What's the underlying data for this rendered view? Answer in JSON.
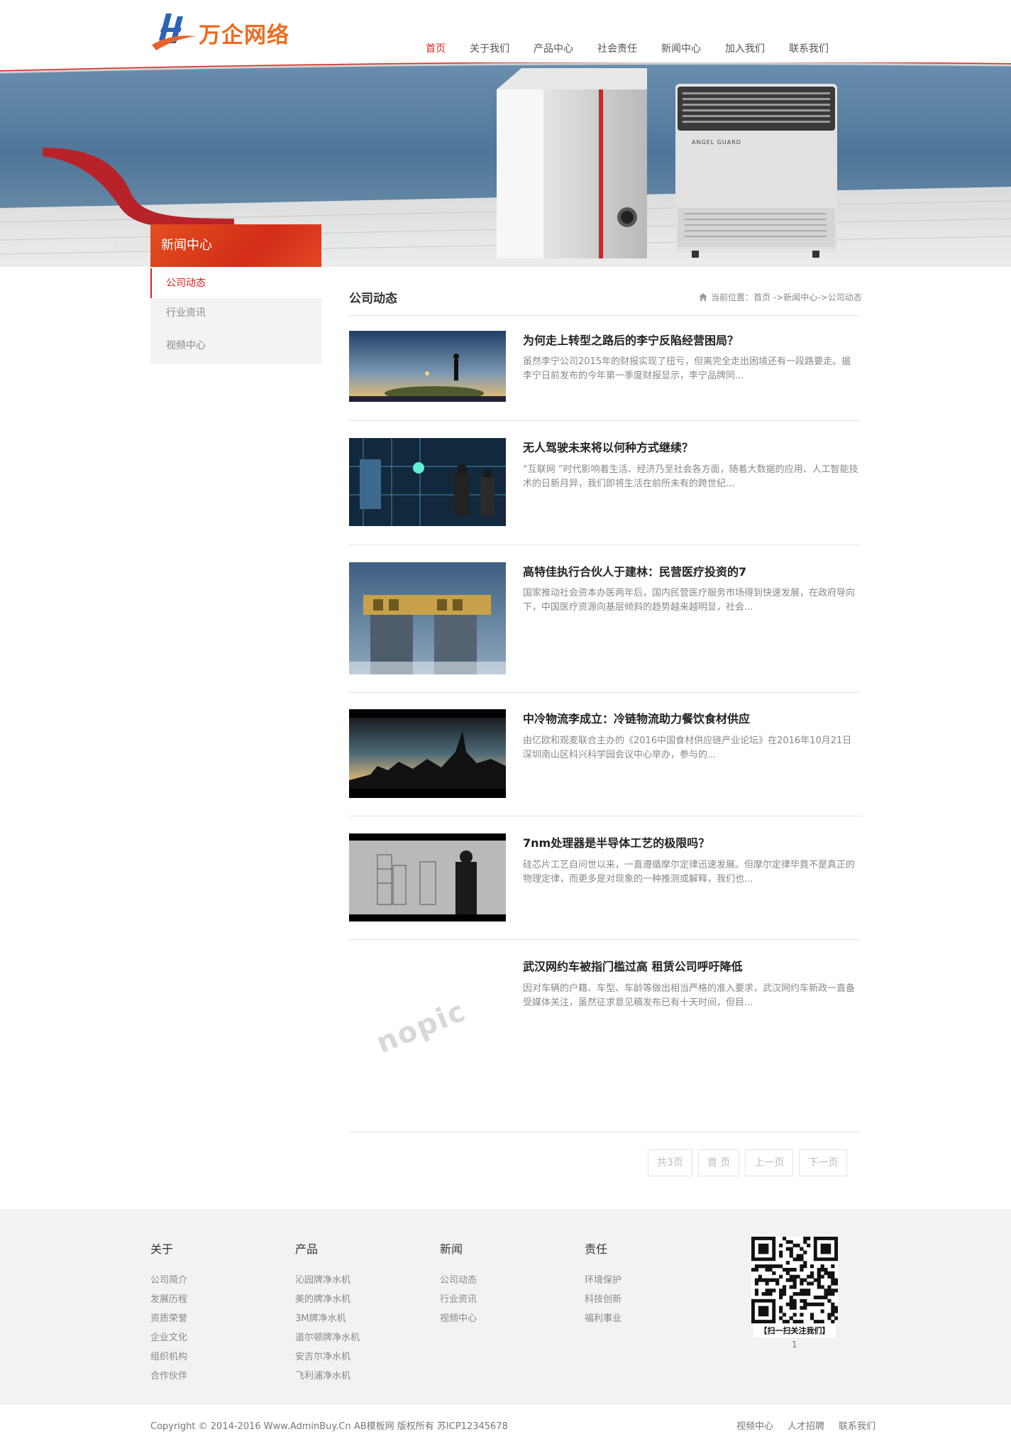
{
  "header": {
    "logo_text": "万企网络",
    "nav": [
      {
        "label": "首页",
        "active": true
      },
      {
        "label": "关于我们"
      },
      {
        "label": "产品中心"
      },
      {
        "label": "社会责任"
      },
      {
        "label": "新闻中心"
      },
      {
        "label": "加入我们"
      },
      {
        "label": "联系我们"
      }
    ]
  },
  "banner": {
    "product_brand": "ANGEL GUARD"
  },
  "sidebar": {
    "title": "新闻中心",
    "items": [
      {
        "label": "公司动态",
        "active": true
      },
      {
        "label": "行业资讯"
      },
      {
        "label": "视频中心"
      }
    ]
  },
  "content": {
    "title": "公司动态",
    "breadcrumb": "当前位置：首页 ->新闻中心->公司动态",
    "news": [
      {
        "title": "为何走上转型之路后的李宁反陷经营困局？",
        "desc": "虽然李宁公司2015年的财报实现了扭亏，但离完全走出困境还有一段路要走。据李宁日前发布的今年第一季度财报显示，李宁品牌同..."
      },
      {
        "title": "无人驾驶未来将以何种方式继续？",
        "desc": "“互联网 ”时代影响着生活、经济乃至社会各方面，随着大数据的应用、人工智能技术的日新月异，我们即将生活在前所未有的跨世纪..."
      },
      {
        "title": "高特佳执行合伙人于建林：民营医疗投资的7",
        "desc": "国家推动社会资本办医两年后，国内民营医疗服务市场得到快速发展，在政府导向下，中国医疗资源向基层倾斜的趋势越来越明显，社会..."
      },
      {
        "title": "中冷物流李成立：冷链物流助力餐饮食材供应",
        "desc": "由亿欧和观麦联合主办的《2016中国食材供应链产业论坛》在2016年10月21日深圳南山区科兴科学园会议中心举办，参与的..."
      },
      {
        "title": "7nm处理器是半导体工艺的极限吗？",
        "desc": "硅芯片工艺自问世以来，一直遵循摩尔定律迅速发展。但摩尔定律毕竟不是真正的物理定律，而更多是对现象的一种推测或解释，我们也..."
      },
      {
        "title": "武汉网约车被指门槛过高 租赁公司呼吁降低",
        "desc": "因对车辆的户籍、车型、车龄等做出相当严格的准入要求，武汉网约车新政一直备受媒体关注，虽然征求意见稿发布已有十天时间，但目..."
      }
    ],
    "nopic_label": "nopic",
    "pager": [
      "共3页",
      "首 页",
      "上一页",
      "下一页"
    ]
  },
  "footer": {
    "cols": [
      {
        "head": "关于",
        "links": [
          "公司简介",
          "发展历程",
          "资质荣誉",
          "企业文化",
          "组织机构",
          "合作伙伴"
        ]
      },
      {
        "head": "产品",
        "links": [
          "沁园牌净水机",
          "美的牌净水机",
          "3M牌净水机",
          "道尔顿牌净水机",
          "安吉尔净水机",
          "飞利浦净水机"
        ]
      },
      {
        "head": "新闻",
        "links": [
          "公司动态",
          "行业资讯",
          "视频中心"
        ]
      },
      {
        "head": "责任",
        "links": [
          "环境保护",
          "科技创新",
          "福利事业"
        ]
      }
    ],
    "qr_caption": "【扫一扫关注我们】",
    "qr_number": "1",
    "copyright": "Copyright © 2014-2016 Www.AdminBuy.Cn AB模板网 版权所有    苏ICP12345678",
    "bottom_links": [
      "视频中心",
      "人才招聘",
      "联系我们"
    ]
  }
}
